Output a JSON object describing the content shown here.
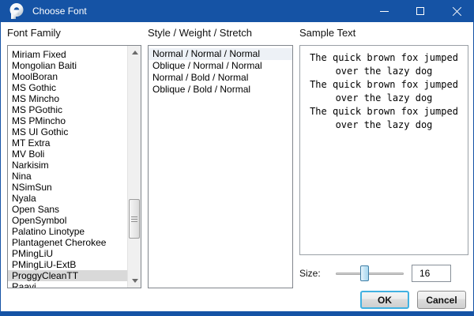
{
  "window": {
    "title": "Choose Font"
  },
  "colors": {
    "titlebar_blue": "#1553a5",
    "selected_gray": "#d9d9d9",
    "selected_light": "#edf1f6",
    "ok_focus_ring": "#41b1e1"
  },
  "font_family": {
    "label": "Font Family",
    "selected_index": 20,
    "items": [
      "Miriam Fixed",
      "Mongolian Baiti",
      "MoolBoran",
      "MS Gothic",
      "MS Mincho",
      "MS PGothic",
      "MS PMincho",
      "MS UI Gothic",
      "MT Extra",
      "MV Boli",
      "Narkisim",
      "Nina",
      "NSimSun",
      "Nyala",
      "Open Sans",
      "OpenSymbol",
      "Palatino Linotype",
      "Plantagenet Cherokee",
      "PMingLiU",
      "PMingLiU-ExtB",
      "ProggyCleanTT",
      "Raavi"
    ]
  },
  "style_list": {
    "label": "Style / Weight / Stretch",
    "selected_index": 0,
    "items": [
      "Normal / Normal / Normal",
      "Oblique / Normal / Normal",
      "Normal / Bold / Normal",
      "Oblique / Bold / Normal"
    ]
  },
  "sample": {
    "label": "Sample Text",
    "lines": [
      "The quick brown fox jumped",
      "over the lazy dog",
      "The quick brown fox jumped",
      "over the lazy dog",
      "The quick brown fox jumped",
      "over the lazy dog"
    ]
  },
  "size": {
    "label": "Size:",
    "value": "16"
  },
  "buttons": {
    "ok": "OK",
    "cancel": "Cancel"
  }
}
